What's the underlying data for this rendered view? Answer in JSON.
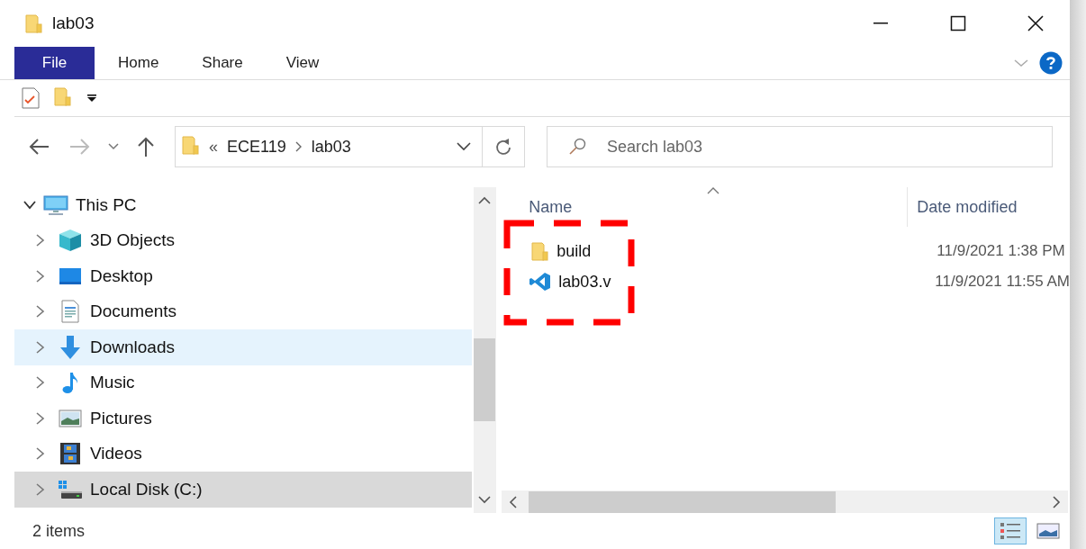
{
  "window": {
    "title": "lab03"
  },
  "ribbon": {
    "tabs": [
      {
        "label": "File",
        "selected": true
      },
      {
        "label": "Home",
        "selected": false
      },
      {
        "label": "Share",
        "selected": false
      },
      {
        "label": "View",
        "selected": false
      }
    ]
  },
  "address": {
    "overflow": "«",
    "crumbs": [
      "ECE119",
      "lab03"
    ]
  },
  "search": {
    "placeholder": "Search lab03"
  },
  "tree": [
    {
      "label": "This PC",
      "kind": "pc",
      "expanded": true,
      "selected": false,
      "hovered": false,
      "children": [
        {
          "label": "3D Objects",
          "kind": "cube",
          "expanded": false,
          "selected": false,
          "hovered": false
        },
        {
          "label": "Desktop",
          "kind": "desktop",
          "expanded": false,
          "selected": false,
          "hovered": false
        },
        {
          "label": "Documents",
          "kind": "documents",
          "expanded": false,
          "selected": false,
          "hovered": false
        },
        {
          "label": "Downloads",
          "kind": "downloads",
          "expanded": false,
          "selected": false,
          "hovered": true
        },
        {
          "label": "Music",
          "kind": "music",
          "expanded": false,
          "selected": false,
          "hovered": false
        },
        {
          "label": "Pictures",
          "kind": "pictures",
          "expanded": false,
          "selected": false,
          "hovered": false
        },
        {
          "label": "Videos",
          "kind": "videos",
          "expanded": false,
          "selected": false,
          "hovered": false
        },
        {
          "label": "Local Disk (C:)",
          "kind": "disk",
          "expanded": false,
          "selected": true,
          "hovered": false
        }
      ]
    }
  ],
  "files": {
    "columns": [
      "Name",
      "Date modified"
    ],
    "rows": [
      {
        "name": "build",
        "kind": "folder",
        "date": "11/9/2021 1:38 PM"
      },
      {
        "name": "lab03.v",
        "kind": "code",
        "date": "11/9/2021 11:55 AM"
      }
    ]
  },
  "status_bar": {
    "count": "2 items",
    "views": [
      {
        "kind": "details",
        "selected": true
      },
      {
        "kind": "large",
        "selected": false
      }
    ]
  }
}
